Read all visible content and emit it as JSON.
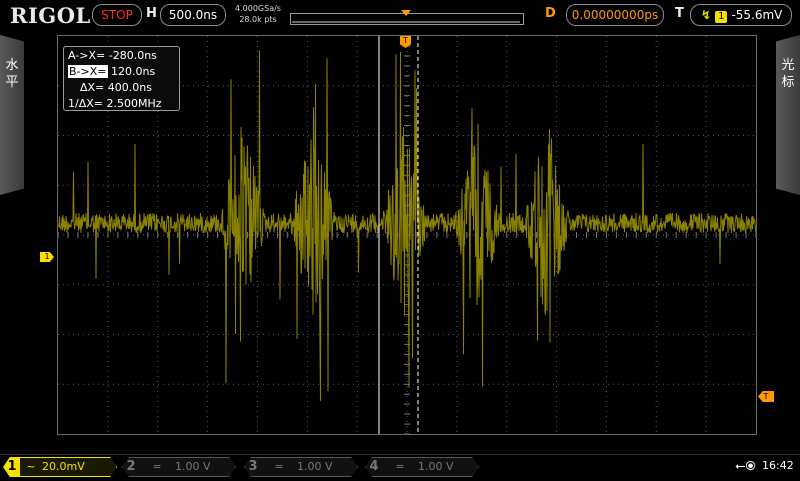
{
  "brand": {
    "logo": "RIGOL"
  },
  "status": {
    "run_state": "STOP",
    "run_color": "#ff2d2d"
  },
  "horizontal": {
    "label": "H",
    "timebase": "500.0ns",
    "sample_rate": "4.000GSa/s",
    "memory_depth": "28.0k pts"
  },
  "delay": {
    "label": "D",
    "value": "0.00000000ps"
  },
  "trigger": {
    "label": "T",
    "source": "1",
    "level": "-55.6mV",
    "color": "#ff9a00",
    "top_marker": "T",
    "level_marker": "T"
  },
  "side_tabs": {
    "left": "水平",
    "right": "光标"
  },
  "cursors": {
    "a_label": "A->X=",
    "a_value": "-280.0ns",
    "b_label": "B->X=",
    "b_value": "120.0ns",
    "dx_label": "ΔX=",
    "dx_value": "400.0ns",
    "inv_dx_label": "1/ΔX=",
    "inv_dx_value": "2.500MHz",
    "selected": "B"
  },
  "channels": [
    {
      "num": "1",
      "coupling": "~",
      "scale": "20.0mV",
      "active": true,
      "color": "#f5e000"
    },
    {
      "num": "2",
      "coupling": "=",
      "scale": "1.00 V",
      "active": false
    },
    {
      "num": "3",
      "coupling": "=",
      "scale": "1.00 V",
      "active": false
    },
    {
      "num": "4",
      "coupling": "=",
      "scale": "1.00 V",
      "active": false
    }
  ],
  "ch1_marker": "1",
  "system": {
    "usb_icon": "usb-icon",
    "clock": "16:42"
  },
  "colors": {
    "trace": "#8a8200",
    "grid": "#5a5a5a",
    "accent_orange": "#ff9a00",
    "ch1_yellow": "#f5e000"
  },
  "waveform": {
    "bursts": [
      -3.3,
      -1.9,
      -0.05,
      1.4,
      2.8
    ],
    "cursor_a_div": -1.4,
    "cursor_b_div": 0.24
  }
}
